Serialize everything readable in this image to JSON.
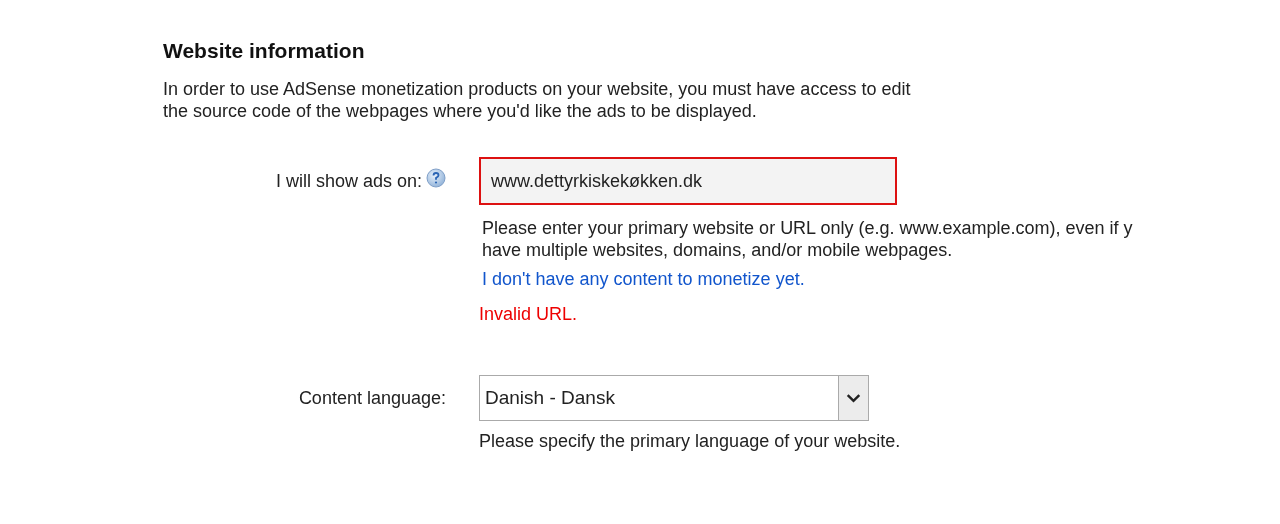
{
  "section": {
    "title": "Website information",
    "intro_lines": [
      "In order to use AdSense monetization products on your website, you must have access to edit",
      "the source code of the webpages where you'd like the ads to be displayed."
    ]
  },
  "website_field": {
    "label": "I will show ads on:",
    "value": "www.dettyrkiskekøkken.dk",
    "invalid": true,
    "help_lines": [
      "Please enter your primary website or URL only (e.g. www.example.com), even if y",
      "have multiple websites, domains, and/or mobile webpages."
    ],
    "link": "I don't have any content to monetize yet.",
    "error": "Invalid URL."
  },
  "language_field": {
    "label": "Content language:",
    "value": "Danish - Dansk",
    "help": "Please specify the primary language of your website."
  }
}
